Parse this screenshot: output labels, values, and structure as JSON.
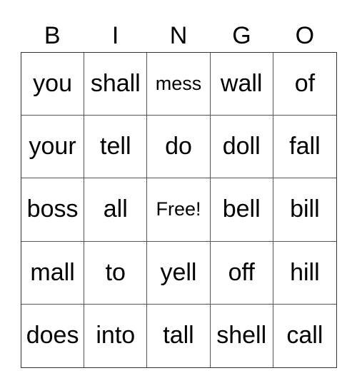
{
  "header": [
    "B",
    "I",
    "N",
    "G",
    "O"
  ],
  "cells": [
    [
      "you",
      "shall",
      "mess",
      "wall",
      "of"
    ],
    [
      "your",
      "tell",
      "do",
      "doll",
      "fall"
    ],
    [
      "boss",
      "all",
      "Free!",
      "bell",
      "bill"
    ],
    [
      "mall",
      "to",
      "yell",
      "off",
      "hill"
    ],
    [
      "does",
      "into",
      "tall",
      "shell",
      "call"
    ]
  ]
}
